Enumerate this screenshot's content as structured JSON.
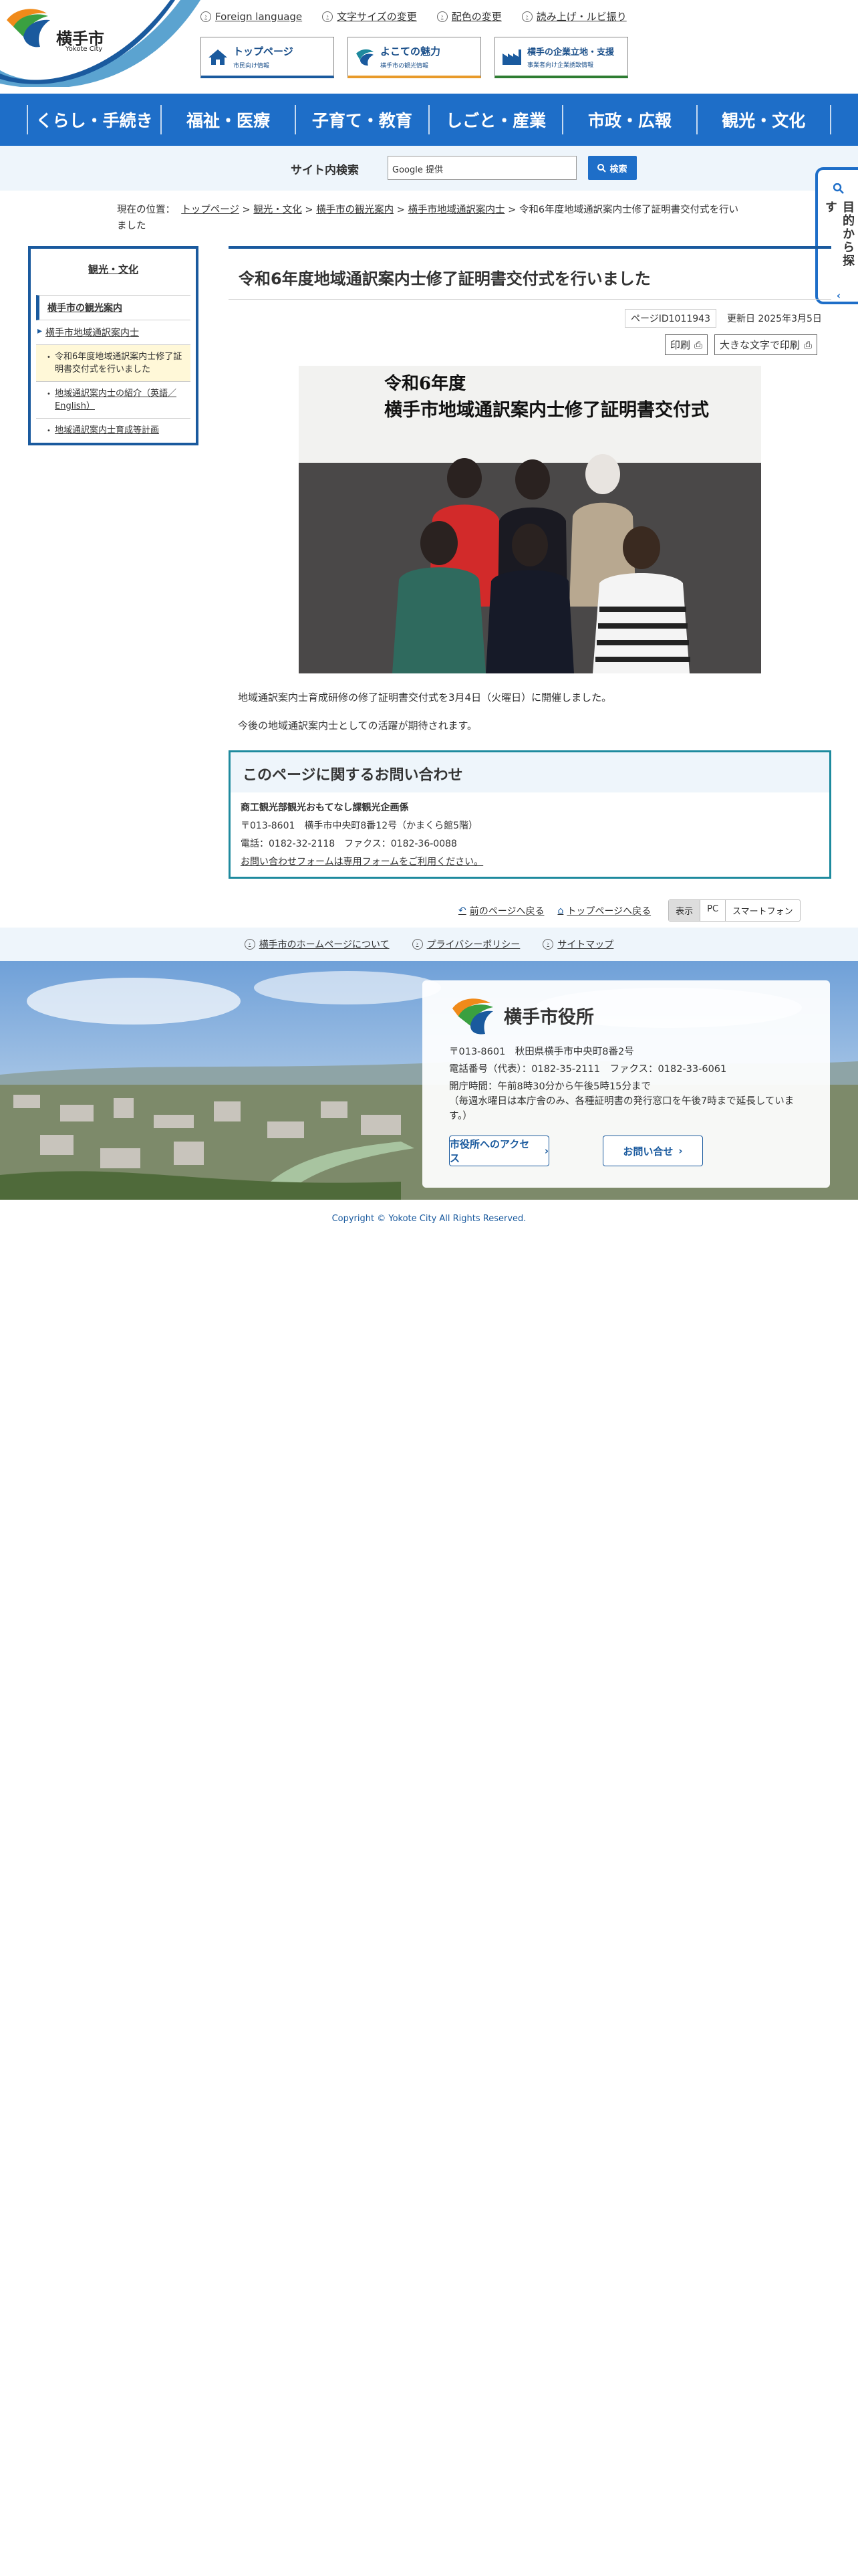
{
  "site": {
    "name": "横手市",
    "name_en": "Yokote City"
  },
  "utility": [
    {
      "label": "Foreign language",
      "icon": "globe-icon"
    },
    {
      "label": "文字サイズの変更",
      "icon": "text-size-icon"
    },
    {
      "label": "配色の変更",
      "icon": "color-icon"
    },
    {
      "label": "読み上げ・ルビ振り",
      "icon": "speaker-icon"
    }
  ],
  "header_buttons": [
    {
      "title": "トップページ",
      "sub": "市民向け情報",
      "color": "#1a5a9e"
    },
    {
      "title": "よこての魅力",
      "sub": "横手市の観光情報",
      "color": "#1e8a9e"
    },
    {
      "title": "横手の企業立地・支援",
      "sub": "事業者向け企業誘致情報",
      "color": "#2e7d32"
    }
  ],
  "global_nav": [
    "くらし・手続き",
    "福祉・医療",
    "子育て・教育",
    "しごと・産業",
    "市政・広報",
    "観光・文化"
  ],
  "search": {
    "label": "サイト内検索",
    "placeholder": "Google 提供",
    "button": "検索"
  },
  "side_tab": {
    "label": "目的から探す"
  },
  "breadcrumb": {
    "prefix": "現在の位置：",
    "items": [
      "トップページ",
      "観光・文化",
      "横手市の観光案内",
      "横手市地域通訳案内士"
    ],
    "current": "令和6年度地域通訳案内士修了証明書交付式を行いました"
  },
  "sidebar": {
    "title": "観光・文化",
    "level1": "横手市の観光案内",
    "level2": "横手市地域通訳案内士",
    "items": [
      "令和6年度地域通訳案内士修了証明書交付式を行いました",
      "地域通訳案内士の紹介（英語／English）",
      "地域通訳案内士育成等計画"
    ]
  },
  "page": {
    "title": "令和6年度地域通訳案内士修了証明書交付式を行いました",
    "page_id": "ページID1011943",
    "updated": "更新日 2025年3月5日",
    "print": "印刷",
    "print_large": "大きな文字で印刷",
    "photo_caption_line1": "令和6年度",
    "photo_caption_line2": "横手市地域通訳案内士修了証明書交付式",
    "paragraphs": [
      "地域通訳案内士育成研修の修了証明書交付式を3月4日（火曜日）に開催しました。",
      "今後の地域通訳案内士としての活躍が期待されます。"
    ]
  },
  "contact": {
    "heading": "このページに関するお問い合わせ",
    "dept": "商工観光部観光おもてなし課観光企画係",
    "address": "〒013-8601　横手市中央町8番12号（かまくら館5階）",
    "phone": "電話：0182-32-2118　ファクス：0182-36-0088",
    "form": "お問い合わせフォームは専用フォームをご利用ください。"
  },
  "bottom_nav": {
    "back": "前のページへ戻る",
    "top": "トップページへ戻る",
    "display_label": "表示",
    "pc": "PC",
    "sp": "スマートフォン"
  },
  "footer_links": [
    "横手市のホームページについて",
    "プライバシーポリシー",
    "サイトマップ"
  ],
  "footer": {
    "office": "横手市役所",
    "address": "〒013-8601　秋田県横手市中央町8番2号",
    "phone": "電話番号（代表）：0182-35-2111　ファクス：0182-33-6061",
    "hours1": "開庁時間：午前8時30分から午後5時15分まで",
    "hours2": "（毎週水曜日は本庁舎のみ、各種証明書の発行窓口を午後7時まで延長しています。）",
    "access": "市役所へのアクセス",
    "inquiry": "お問い合せ"
  },
  "copyright": "Copyright © Yokote City All Rights Reserved."
}
